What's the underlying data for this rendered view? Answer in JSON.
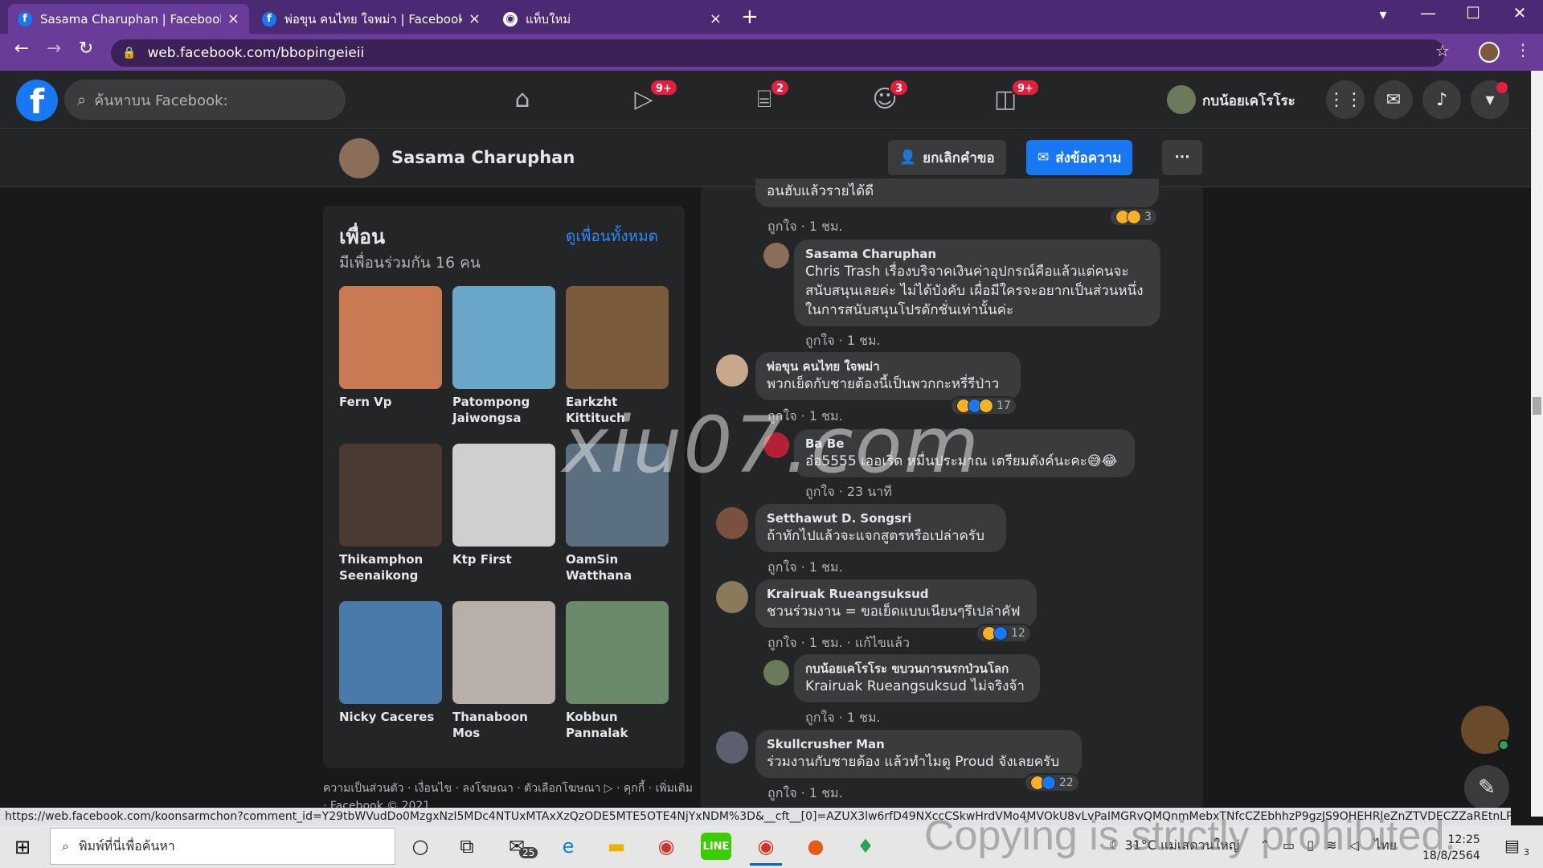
{
  "browser": {
    "tabs": [
      {
        "title": "Sasama Charuphan | Facebook",
        "active": true
      },
      {
        "title": "พ่อขุน คนไทย ใจพม่า | Facebook",
        "active": false
      },
      {
        "title": "แท็บใหม่",
        "active": false
      }
    ],
    "url": "web.facebook.com/bbopingeieii",
    "icons": {
      "back": "←",
      "forward": "→",
      "reload": "↻",
      "lock": "🔒",
      "star": "☆",
      "menu": "⋮",
      "close": "×",
      "newtab": "+",
      "minimize": "—",
      "maximize": "☐",
      "winclose": "✕",
      "profile_menu": "▾"
    }
  },
  "facebook": {
    "search_placeholder": "ค้นหาบน Facebook:",
    "badges": {
      "watch": "9+",
      "marketplace": "2",
      "groups": "3",
      "gaming": "9+"
    },
    "user_name": "กบน้อยเคโรโระ"
  },
  "profile": {
    "name": "Sasama Charuphan",
    "cancel_request_label": "ยกเลิกคำขอ",
    "message_label": "ส่งข้อความ",
    "more_label": "···"
  },
  "friends": {
    "title": "เพื่อน",
    "see_all": "ดูเพื่อนทั้งหมด",
    "mutual": "มีเพื่อนร่วมกัน 16 คน",
    "list": [
      {
        "name": "Fern Vp",
        "color": "#c97a52"
      },
      {
        "name": "Patompong Jaiwongsa",
        "color": "#6aa6c8"
      },
      {
        "name": "Earkzht Kittituch",
        "color": "#7a5a3a"
      },
      {
        "name": "Thikamphon Seenaikong",
        "color": "#4a3a32"
      },
      {
        "name": "Ktp First",
        "color": "#cfcfcf"
      },
      {
        "name": "OamSin Watthana",
        "color": "#5a7080"
      },
      {
        "name": "Nicky Caceres",
        "color": "#4a7aa8"
      },
      {
        "name": "Thanaboon Mos",
        "color": "#b8b0a8"
      },
      {
        "name": "Kobbun Pannalak",
        "color": "#6b8a6a"
      }
    ],
    "footer": "ความเป็นส่วนตัว · เงื่อนไข · ลงโฆษณา · ตัวเลือกโฆษณา ▷ · คุกกี้ · เพิ่มเติม · Facebook © 2021"
  },
  "comments": [
    {
      "text": "อนฮับแล้วรายได้ดี",
      "meta": "ถูกใจ · 1 ชม.",
      "reaction_count": "3"
    },
    {
      "name": "Sasama Charuphan",
      "text": "Chris Trash เรื่องบริจาคเงินค่าอุปกรณ์คือแล้วแต่คนจะสนับสนุนเลยค่ะ ไม่ได้บังคับ เผื่อมีใครจะอยากเป็นส่วนหนึ่งในการสนับสนุนโปรดักชั่นเท่านั้นค่ะ",
      "meta": "ถูกใจ · 1 ชม."
    },
    {
      "name": "พ่อขุน คนไทย ใจพม่า",
      "text": "พวกเย็ดกับชายต้องนี้เป็นพวกกะหรี่รีป่าว",
      "meta": "ถูกใจ · 1 ชม.",
      "reaction_count": "17"
    },
    {
      "name": "Ba Be",
      "text": "อ๋อ5555 เออเริ่ด หมื่นประมาณ เตรียมตังค์นะคะ😅😂",
      "meta": "ถูกใจ · 23 นาที"
    },
    {
      "name": "Setthawut D. Songsri",
      "text": "ถ้าทักไปแล้วจะแจกสูตรหรือเปล่าครับ",
      "meta": "ถูกใจ · 1 ชม."
    },
    {
      "name": "Krairuak Rueangsuksud",
      "text": "ชวนร่วมงาน = ขอเย็ดแบบเนียนๆรึเปล่าคัฟ",
      "meta": "ถูกใจ · 1 ชม. · แก้ไขแล้ว",
      "reaction_count": "12"
    },
    {
      "name": "กบน้อยเคโรโระ ขบวนการนรกป่วนโลก",
      "text": "Krairuak Rueangsuksud ไม่จริงจ้า",
      "meta": "ถูกใจ · 1 ชม."
    },
    {
      "name": "Skullcrusher Man",
      "text": "ร่วมงานกับชายต้อง แล้วทำไมดู Proud จังเลยครับ",
      "meta": "ถูกใจ · 1 ชม.",
      "reaction_count": "22"
    }
  ],
  "status_url": "https://web.facebook.com/koonsarmchon?comment_id=Y29tbWVudDo0MzgxNzI5MDc4NTUxMTAxXzQzODE5MTE5OTE4NjYxNDM%3D&__cft__[0]=AZUX3lw6rfD49NXccCSkwHrdVMo4MVOkU8vLvPaIMGRvQMQnmMebxTNfcCZEbhhzP9gzJS9OHEHRleZnZTVDECZZaREtnLPBhAKrb9...",
  "taskbar": {
    "search_text": "พิมพ์ที่นี่เพื่อค้นหา",
    "mail_badge": "25",
    "weather": "31°C แม่เสดวนใหญ่",
    "language": "ไทย",
    "time": "12:25",
    "date": "18/8/2564",
    "notif_count": "3"
  },
  "watermarks": {
    "center": "xiu07.com",
    "bottom": "Copying is strictly prohibited."
  }
}
